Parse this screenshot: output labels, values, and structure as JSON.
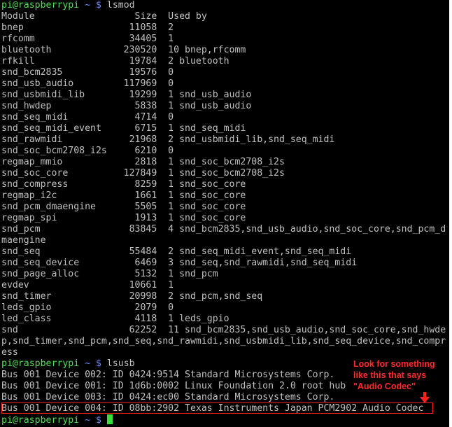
{
  "prompt": {
    "user_host": "pi@raspberrypi",
    "path": "~ $"
  },
  "commands": {
    "lsmod": "lsmod",
    "lsusb": "lsusb"
  },
  "lsmod_header": "Module                  Size  Used by",
  "lsmod_lines": [
    "bnep                   11058  2",
    "rfcomm                 34405  1",
    "bluetooth             230520  10 bnep,rfcomm",
    "rfkill                 19784  2 bluetooth",
    "snd_bcm2835            19576  0",
    "snd_usb_audio         117969  0",
    "snd_usbmidi_lib        19299  1 snd_usb_audio",
    "snd_hwdep               5838  1 snd_usb_audio",
    "snd_seq_midi            4714  0",
    "snd_seq_midi_event      6715  1 snd_seq_midi",
    "snd_rawmidi            21968  2 snd_usbmidi_lib,snd_seq_midi",
    "snd_soc_bcm2708_i2s     6210  0",
    "regmap_mmio             2818  1 snd_soc_bcm2708_i2s",
    "snd_soc_core          127849  1 snd_soc_bcm2708_i2s",
    "snd_compress            8259  1 snd_soc_core",
    "regmap_i2c              1661  1 snd_soc_core",
    "snd_pcm_dmaengine       5505  1 snd_soc_core",
    "regmap_spi              1913  1 snd_soc_core",
    "snd_pcm                83845  4 snd_bcm2835,snd_usb_audio,snd_soc_core,snd_pcm_d",
    "maengine",
    "snd_seq                55484  2 snd_seq_midi_event,snd_seq_midi",
    "snd_seq_device          6469  3 snd_seq,snd_rawmidi,snd_seq_midi",
    "snd_page_alloc          5132  1 snd_pcm",
    "evdev                  10661  1",
    "snd_timer              20998  2 snd_pcm,snd_seq",
    "leds_gpio               2079  0",
    "led_class               4118  1 leds_gpio",
    "snd                    62252  11 snd_bcm2835,snd_usb_audio,snd_soc_core,snd_hwde",
    "p,snd_timer,snd_pcm,snd_seq,snd_rawmidi,snd_usbmidi_lib,snd_seq_device,snd_compr",
    "ess"
  ],
  "lsusb_lines": [
    "Bus 001 Device 002: ID 0424:9514 Standard Microsystems Corp.",
    "Bus 001 Device 001: ID 1d6b:0002 Linux Foundation 2.0 root hub",
    "Bus 001 Device 003: ID 0424:ec00 Standard Microsystems Corp.",
    "Bus 001 Device 004: ID 08bb:2902 Texas Instruments Japan PCM2902 Audio Codec"
  ],
  "annotation": {
    "line1": "Look for something",
    "line2": "like this that says",
    "line3": "\"Audio Codec\""
  },
  "colors": {
    "background": "#000000",
    "text": "#c0c0c0",
    "prompt_user": "#4ee04e",
    "prompt_path": "#6f8cff",
    "annotation": "#ff2a2a",
    "cursor": "#3cdc3c"
  }
}
